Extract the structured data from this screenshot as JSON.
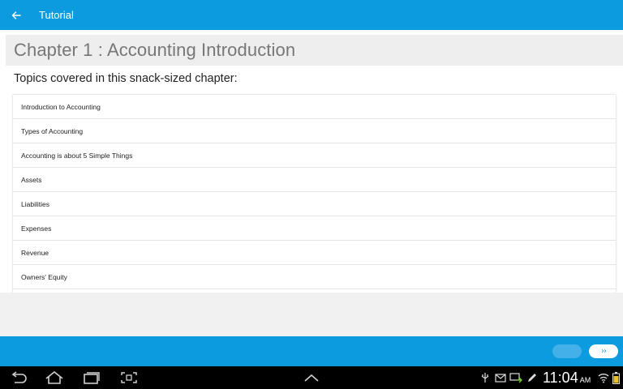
{
  "actionbar": {
    "title": "Tutorial",
    "back_icon": "arrow-left-icon"
  },
  "chapter": {
    "title": "Chapter 1 : Accounting Introduction",
    "intro": "Topics covered in this snack-sized chapter:",
    "topics": [
      "Introduction to Accounting",
      "Types of Accounting",
      "Accounting is about 5 Simple Things",
      "Assets",
      "Liabilities",
      "Expenses",
      "Revenue",
      "Owners' Equity"
    ]
  },
  "bottom_nav": {
    "next_label": "››"
  },
  "system_bar": {
    "time": "11:04",
    "ampm": "AM"
  },
  "colors": {
    "accent": "#0d9be0",
    "header_bg": "#eeeeee",
    "title_text": "#777777"
  }
}
